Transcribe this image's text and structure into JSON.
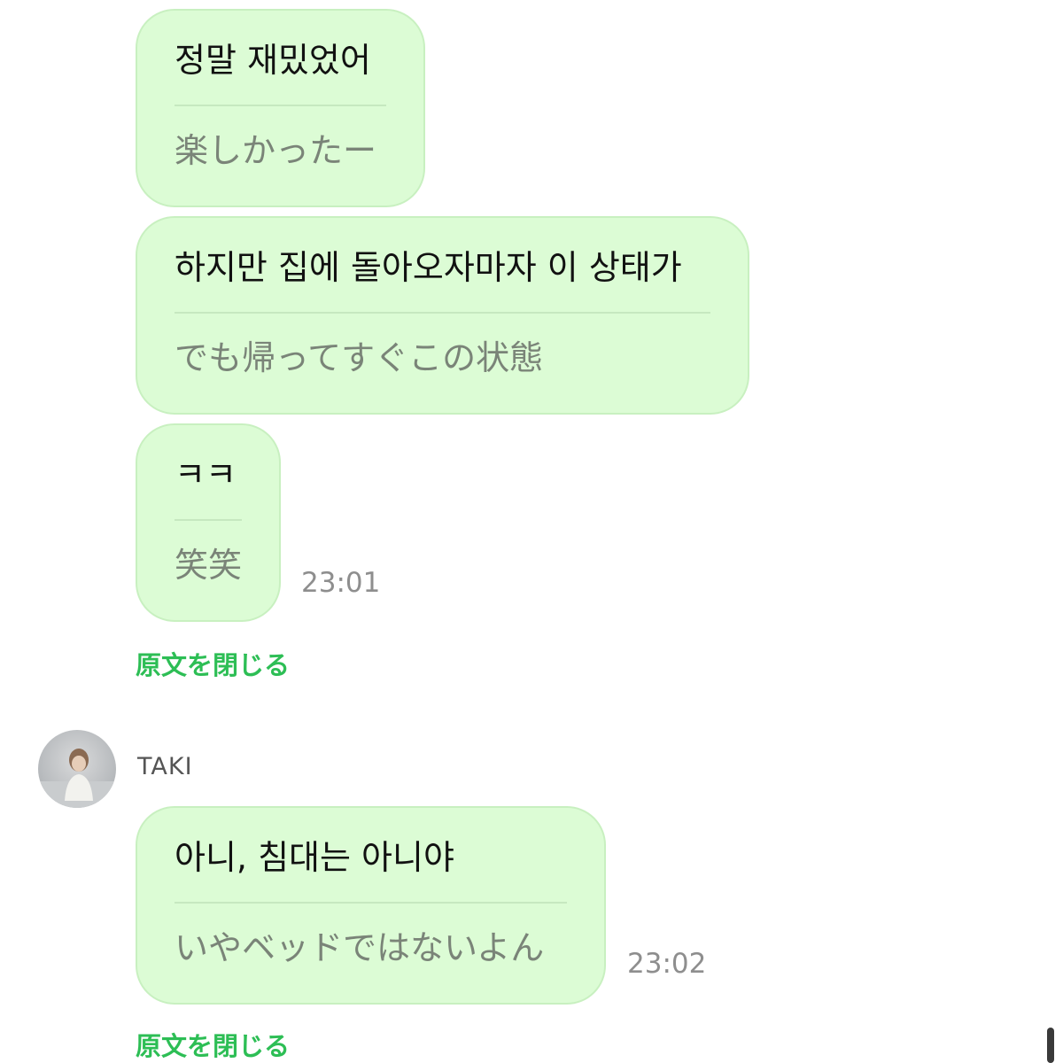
{
  "messages": [
    {
      "original": "정말 재밌었어",
      "translation": "楽しかったー"
    },
    {
      "original": "하지만 집에 돌아오자마자 이 상태가",
      "translation": "でも帰ってすぐこの状態"
    },
    {
      "original": "ㅋㅋ",
      "translation": "笑笑",
      "time": "23:01"
    },
    {
      "original": "아니, 침대는 아니야",
      "translation": "いやベッドではないよん",
      "time": "23:02"
    }
  ],
  "close_original_label": "原文を閉じる",
  "sender": {
    "name": "TAKI",
    "avatar_icon": "user-photo-icon"
  },
  "colors": {
    "bubble_bg": "#dcfcd5",
    "bubble_border": "#c8f0c0",
    "link": "#2dbe55",
    "time": "#8e8e8e"
  }
}
